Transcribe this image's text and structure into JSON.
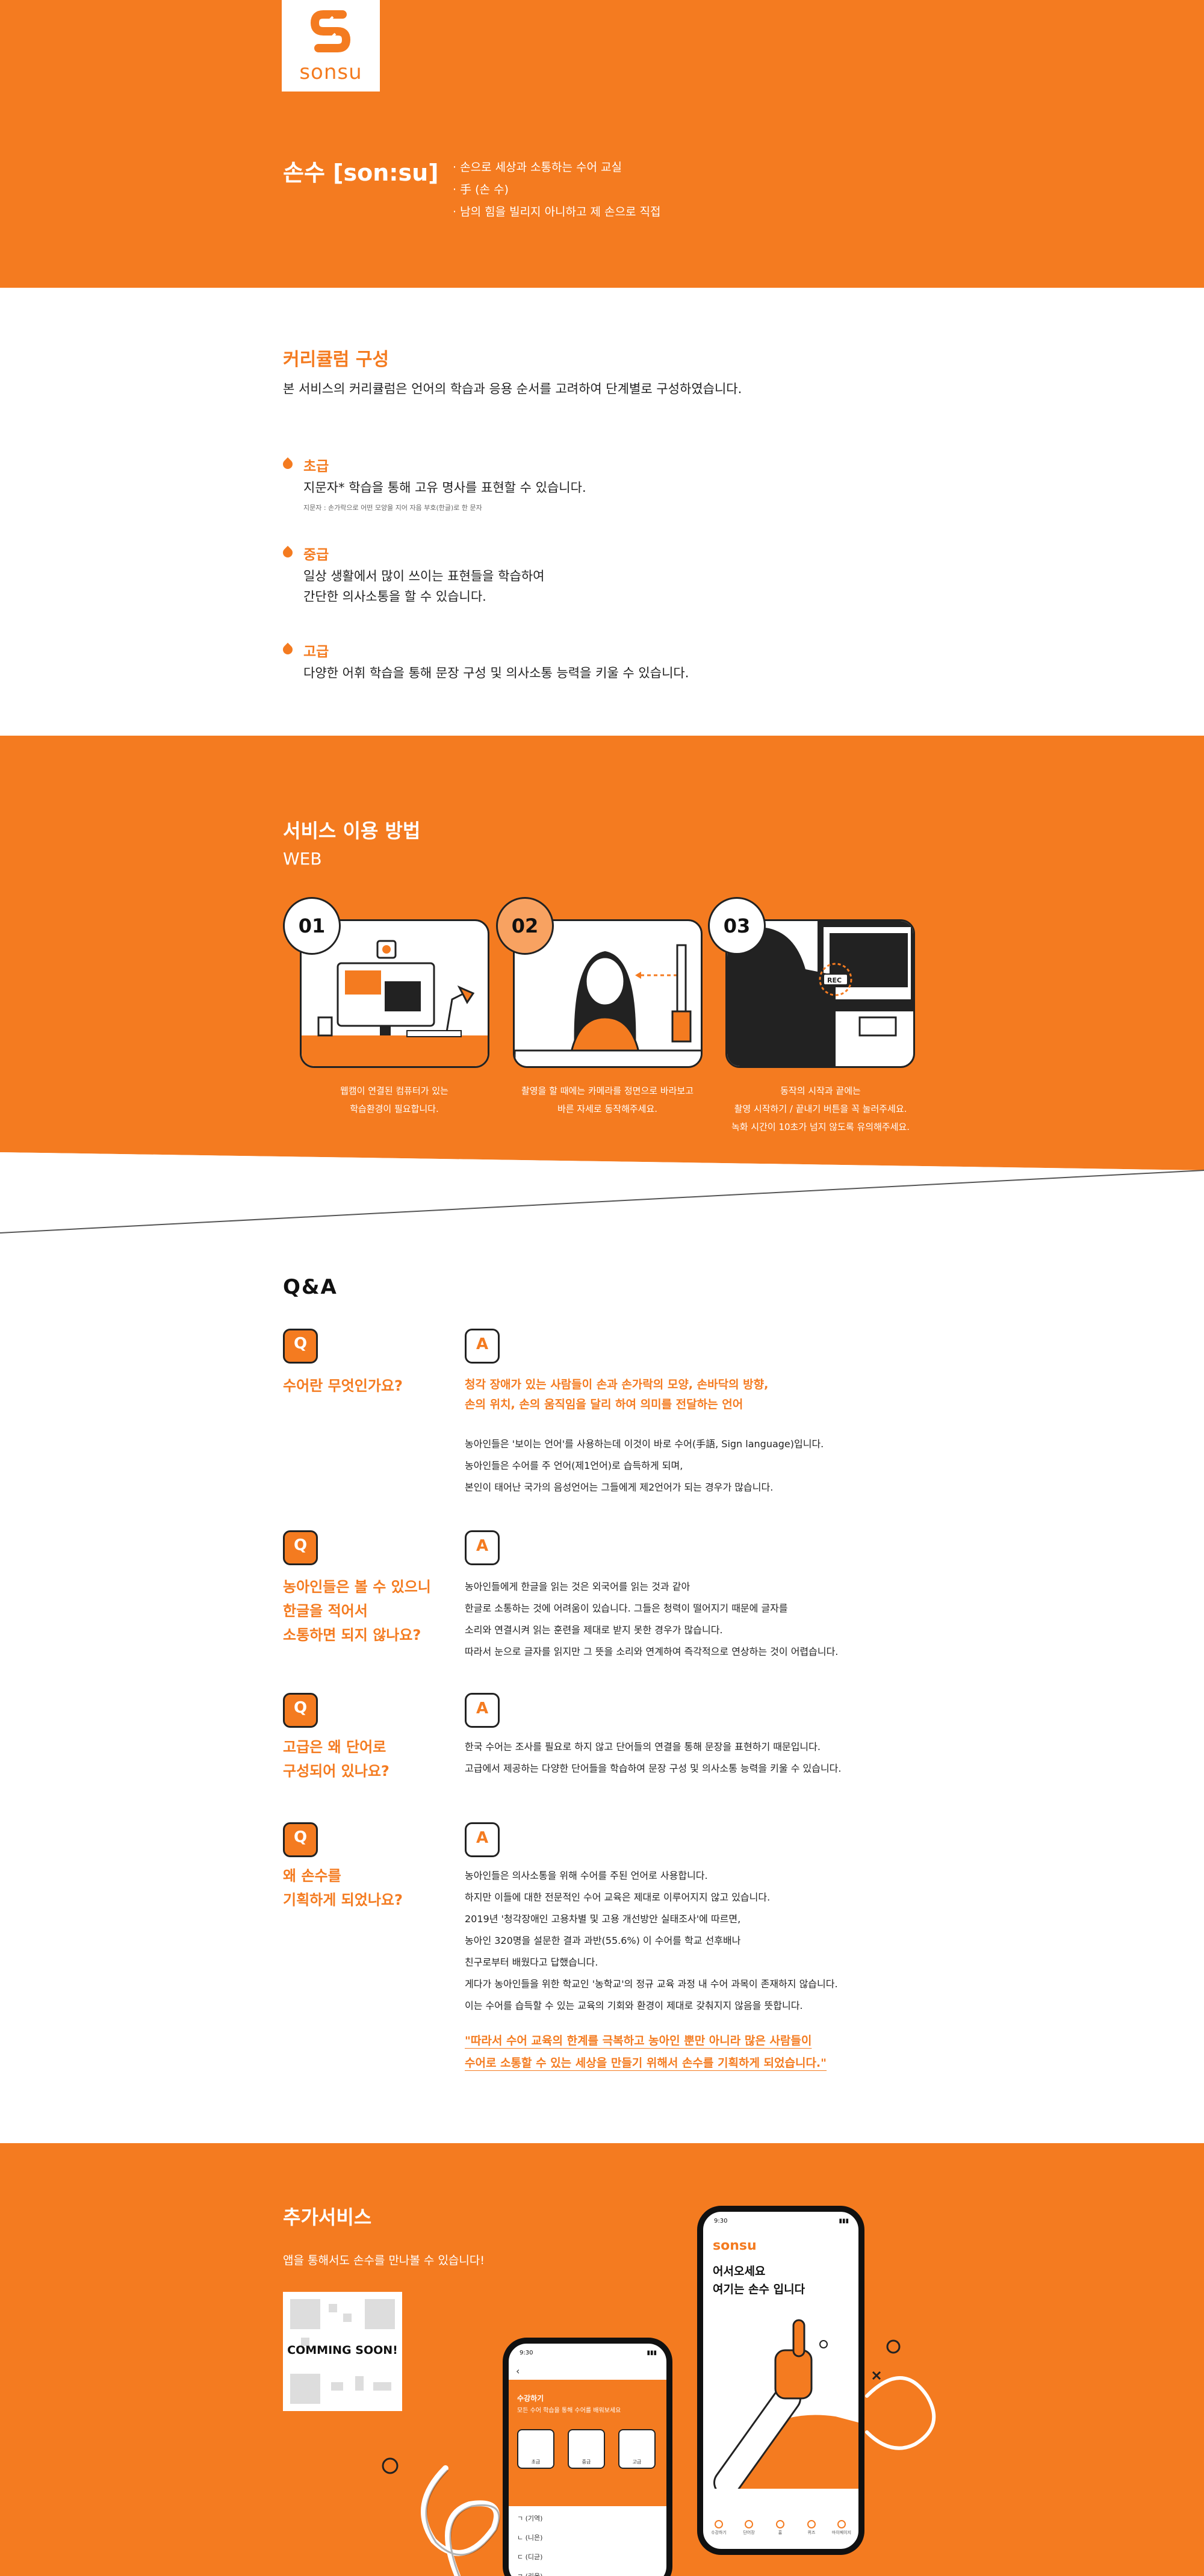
{
  "brand": {
    "logo_word": "sonsu",
    "title": "손수 [son:su]",
    "definitions": [
      "손으로 세상과 소통하는 수어 교실",
      "手 (손 수)",
      "남의 힘을 빌리지 아니하고 제 손으로 직접"
    ]
  },
  "curriculum": {
    "title": "커리큘럼 구성",
    "description": "본 서비스의 커리큘럼은 언어의 학습과 응용 순서를 고려하여 단계별로 구성하였습니다.",
    "levels": [
      {
        "name": "초급",
        "desc": "지문자* 학습을 통해 고유 명사를 표현할 수 있습니다.",
        "note": "지문자 : 손가락으로 어떤 모양을 지어 자음 부호(한글)로 한 문자"
      },
      {
        "name": "중급",
        "desc": "일상 생활에서 많이 쓰이는 표현들을 학습하여",
        "desc2": "간단한 의사소통을 할 수 있습니다."
      },
      {
        "name": "고급",
        "desc": "다양한 어휘 학습을 통해 문장 구성 및 의사소통 능력을 키울 수 있습니다."
      }
    ]
  },
  "service": {
    "title": "서비스 이용 방법",
    "subtitle": "WEB",
    "steps": [
      {
        "num": "01",
        "line1": "웹캠이 연결된 컴퓨터가 있는",
        "line2": "학습환경이 필요합니다.",
        "line3": ""
      },
      {
        "num": "02",
        "line1": "촬영을 할 때에는 카메라를 정면으로 바라보고",
        "line2": "바른 자세로 동작해주세요.",
        "line3": ""
      },
      {
        "num": "03",
        "line1": "동작의 시작과 끝에는",
        "line2": "촬영 시작하기 / 끝내기 버튼을 꼭 눌러주세요.",
        "line3": "녹화 시간이 10초가 넘지 않도록 유의해주세요."
      }
    ],
    "rec_label": "REC"
  },
  "qa": {
    "title": "Q&A",
    "q_label": "Q",
    "a_label": "A",
    "items": [
      {
        "q": [
          "수어란 무엇인가요?"
        ],
        "highlight": [
          "청각 장애가 있는 사람들이 손과 손가락의 모양, 손바닥의 방향,",
          "손의 위치, 손의 움직임을 달리 하여 의미를 전달하는 언어"
        ],
        "body": [
          "농아인들은 '보이는 언어'를 사용하는데 이것이 바로 수어(手語, Sign language)입니다.",
          "농아인들은 수어를 주 언어(제1언어)로 습득하게 되며,",
          "본인이 태어난 국가의 음성언어는 그들에게 제2언어가 되는 경우가 많습니다."
        ]
      },
      {
        "q": [
          "농아인들은 볼 수 있으니",
          "한글을 적어서",
          "소통하면 되지 않나요?"
        ],
        "body": [
          "농아인들에게 한글을 읽는 것은 외국어를 읽는 것과 같아",
          "한글로 소통하는 것에 어려움이 있습니다. 그들은 청력이 떨어지기 때문에 글자를",
          "소리와 연결시켜 읽는 훈련을 제대로 받지 못한 경우가 많습니다.",
          "따라서 눈으로 글자를 읽지만 그 뜻을 소리와 연계하여 즉각적으로 연상하는 것이 어렵습니다."
        ]
      },
      {
        "q": [
          "고급은 왜 단어로",
          "구성되어 있나요?"
        ],
        "body": [
          "한국 수어는 조사를 필요로 하지 않고 단어들의 연결을 통해 문장을 표현하기 때문입니다.",
          "고급에서 제공하는 다양한 단어들을 학습하여 문장 구성 및 의사소통 능력을 키울 수 있습니다."
        ]
      },
      {
        "q": [
          "왜 손수를",
          "기획하게 되었나요?"
        ],
        "body": [
          "농아인들은 의사소통을 위해 수어를 주된 언어로 사용합니다.",
          "하지만 이들에 대한 전문적인 수어 교육은 제대로 이루어지지 않고 있습니다.",
          "2019년 '청각장애인 고용차별 및 고용 개선방안 실태조사'에 따르면,",
          "농아인 320명을 설문한 결과 과반(55.6%) 이 수어를 학교 선후배나",
          "친구로부터 배웠다고 답했습니다.",
          "게다가 농아인들을 위한 학교인 '농학교'의 정규 교육 과정 내 수어 과목이 존재하지 않습니다.",
          "이는 수어를 습득할 수 있는 교육의 기회와 환경이 제대로 갖춰지지 않음을 뜻합니다."
        ],
        "quote": [
          "\"따라서 수어 교육의 한계를 극복하고 농아인 뿐만 아니라 많은 사람들이",
          "수어로 소통할 수 있는 세상을 만들기 위해서 손수를 기획하게 되었습니다.\""
        ]
      }
    ]
  },
  "extra": {
    "title": "추가서비스",
    "description": "앱을 통해서도 손수를 만나볼 수 있습니다!",
    "qr_label": "COMMING SOON!",
    "phone1": {
      "time": "9:30",
      "title": "수강하기",
      "subtitle": "모든 수어 학습을 통해 수어를 배워보세요",
      "tiles": [
        "초급",
        "중급",
        "고급"
      ],
      "rows": [
        "ㄱ (기역)",
        "ㄴ (니은)",
        "ㄷ (디귿)",
        "ㄹ (리을)"
      ]
    },
    "phone2": {
      "time": "9:30",
      "logo": "sonsu",
      "greeting1": "어서오세요",
      "greeting2": "여기는 손수 입니다",
      "tabs": [
        "수강하기",
        "단어장",
        "홈",
        "퀴즈",
        "마이페이지"
      ]
    }
  },
  "colors": {
    "brand_orange": "#f47b20",
    "light_orange": "#f8a261",
    "ink": "#222222"
  }
}
